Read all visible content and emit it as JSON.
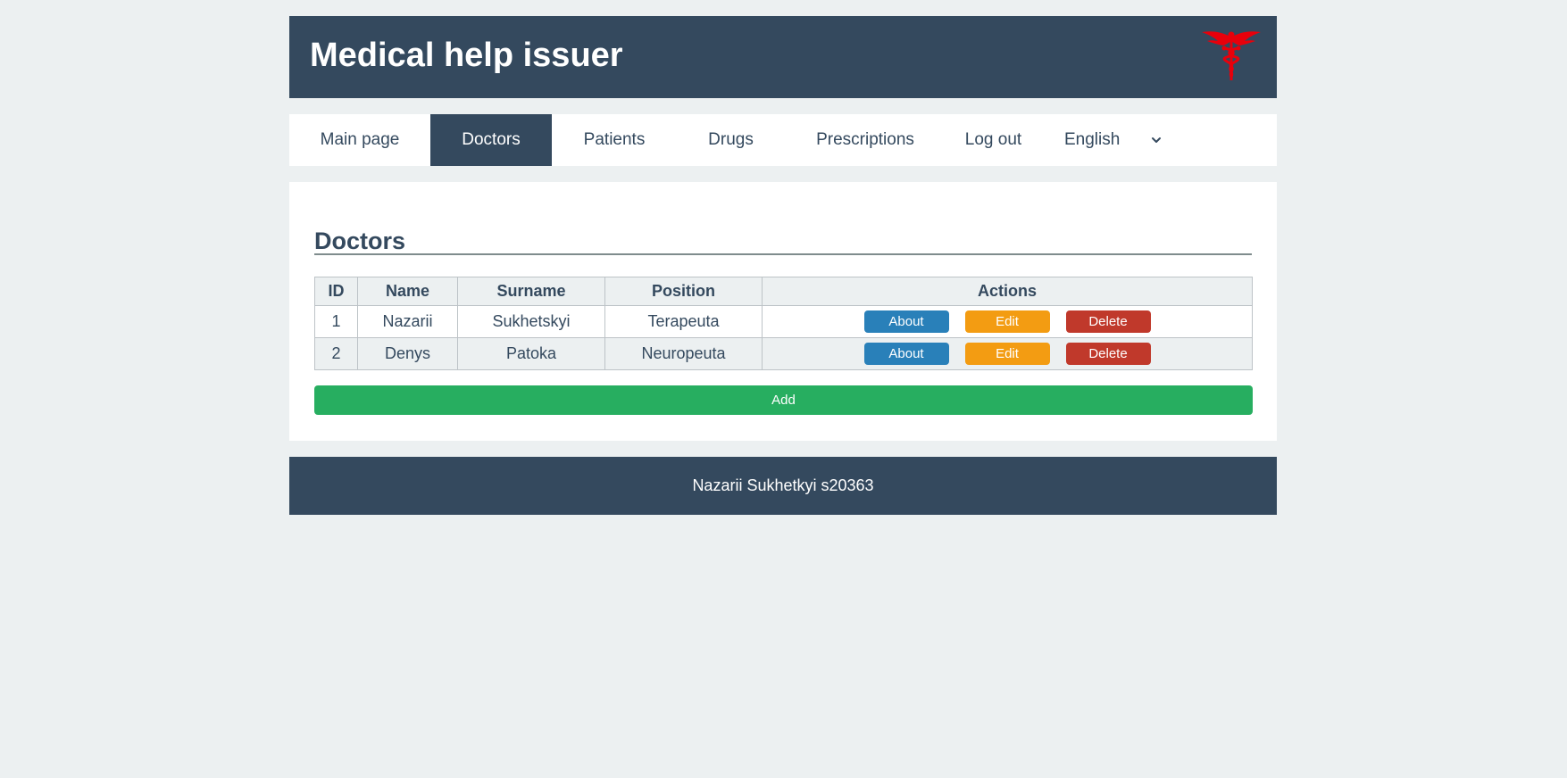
{
  "header": {
    "title": "Medical help issuer",
    "logo_icon": "caduceus-icon",
    "logo_color": "#e8000b"
  },
  "nav": {
    "items": [
      {
        "label": "Main page"
      },
      {
        "label": "Doctors",
        "active": true
      },
      {
        "label": "Patients"
      },
      {
        "label": "Drugs"
      },
      {
        "label": "Prescriptions"
      },
      {
        "label": "Log out"
      }
    ],
    "language": {
      "selected": "English",
      "icon": "chevron-down-icon"
    }
  },
  "main": {
    "heading": "Doctors",
    "table": {
      "columns": [
        "ID",
        "Name",
        "Surname",
        "Position",
        "Actions"
      ],
      "rows": [
        {
          "id": "1",
          "name": "Nazarii",
          "surname": "Sukhetskyi",
          "position": "Terapeuta"
        },
        {
          "id": "2",
          "name": "Denys",
          "surname": "Patoka",
          "position": "Neuropeuta"
        }
      ],
      "actions": {
        "about": "About",
        "edit": "Edit",
        "delete": "Delete"
      }
    },
    "add_label": "Add"
  },
  "footer": {
    "text": "Nazarii Sukhetkyi s20363"
  },
  "colors": {
    "primary": "#34495e",
    "background": "#ecf0f1",
    "about": "#2980b9",
    "edit": "#f39c12",
    "delete": "#c0392b",
    "add": "#27ae60"
  }
}
